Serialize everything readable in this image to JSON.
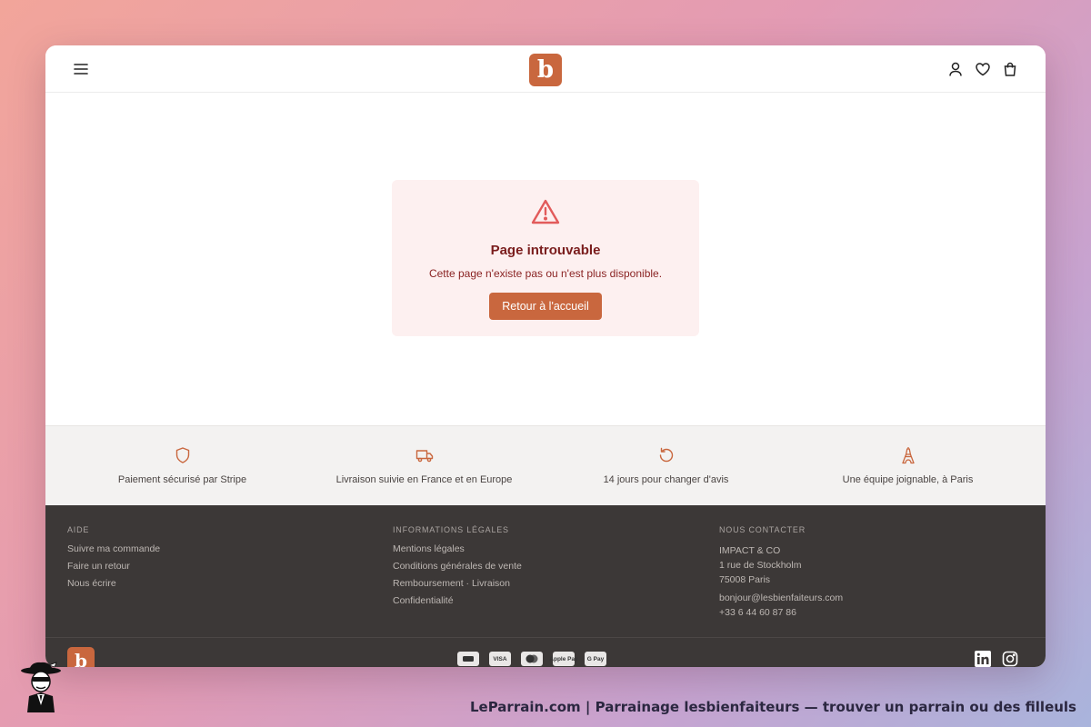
{
  "colors": {
    "accent": "#c9673e",
    "card_bg": "#fdf0f0",
    "error_red": "#e25b5b",
    "footer_bg": "#3c3837",
    "features_bg": "#f3f2f1"
  },
  "header": {
    "menu_icon": "hamburger-menu-icon",
    "logo_letter": "b",
    "icons": [
      "account-icon",
      "wishlist-heart-icon",
      "cart-bag-icon"
    ]
  },
  "error": {
    "icon": "warning-triangle-icon",
    "title": "Page introuvable",
    "message": "Cette page n'existe pas ou n'est plus disponible.",
    "button_label": "Retour à l'accueil"
  },
  "features": [
    {
      "icon": "shield-icon",
      "text": "Paiement sécurisé par Stripe"
    },
    {
      "icon": "truck-icon",
      "text": "Livraison suivie en France et en Europe"
    },
    {
      "icon": "rotate-icon",
      "text": "14 jours pour changer d'avis"
    },
    {
      "icon": "eiffel-tower-icon",
      "text": "Une équipe joignable, à Paris"
    }
  ],
  "footer": {
    "aide": {
      "title": "AIDE",
      "links": [
        "Suivre ma commande",
        "Faire un retour",
        "Nous écrire"
      ]
    },
    "legal": {
      "title": "INFORMATIONS LÉGALES",
      "links": [
        "Mentions légales",
        "Conditions générales de vente",
        "Remboursement · Livraison",
        "Confidentialité"
      ]
    },
    "contact": {
      "title": "NOUS CONTACTER",
      "company": "IMPACT & CO",
      "street": "1 rue de Stockholm",
      "city": "75008 Paris",
      "email": "bonjour@lesbienfaiteurs.com",
      "phone": "+33 6 44 60 87 86"
    },
    "logo_letter": "b",
    "payments": [
      "CB",
      "VISA",
      "Mastercard",
      "Apple Pay",
      "G Pay"
    ],
    "socials": [
      "linkedin-icon",
      "instagram-icon"
    ]
  },
  "caption": "LeParrain.com | Parrainage lesbienfaiteurs — trouver un parrain ou des filleuls"
}
